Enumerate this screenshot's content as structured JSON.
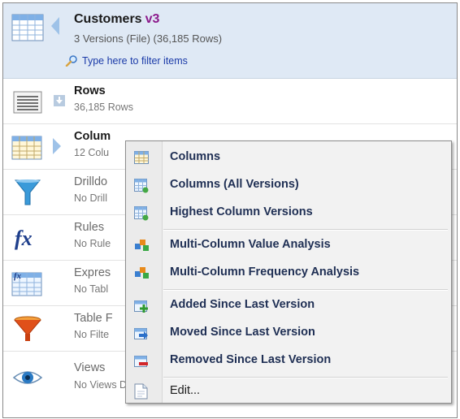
{
  "header": {
    "title": "Customers",
    "version": "v3",
    "subtitle": "3 Versions (File)  (36,185 Rows)",
    "filter_placeholder": "Type here to filter items"
  },
  "rows": [
    {
      "title": "Rows",
      "subtitle": "36,185 Rows"
    },
    {
      "title": "Colum",
      "subtitle": "12 Colu"
    },
    {
      "title": "Drilldo",
      "subtitle": "No Drill"
    },
    {
      "title": "Rules",
      "subtitle": "No Rule"
    },
    {
      "title": "Expres",
      "subtitle": "No Tabl"
    },
    {
      "title": "Table F",
      "subtitle": "No Filte"
    },
    {
      "title": "Views",
      "subtitle": "No Views Defined"
    }
  ],
  "context_menu": {
    "items": [
      {
        "label": "Columns",
        "icon": "columns-table-icon"
      },
      {
        "label": "Columns (All Versions)",
        "icon": "columns-versions-icon"
      },
      {
        "label": "Highest Column Versions",
        "icon": "highest-versions-icon"
      },
      {
        "label": "Multi-Column Value Analysis",
        "icon": "analysis-cubes-icon"
      },
      {
        "label": "Multi-Column Frequency Analysis",
        "icon": "analysis-cubes-icon"
      },
      {
        "label": "Added Since Last Version",
        "icon": "added-column-icon"
      },
      {
        "label": "Moved Since Last Version",
        "icon": "moved-column-icon"
      },
      {
        "label": "Removed Since Last Version",
        "icon": "removed-column-icon"
      },
      {
        "label": "Edit...",
        "icon": "edit-document-icon"
      }
    ]
  },
  "colors": {
    "header_bg": "#dfe9f5",
    "version_color": "#8c1a8c",
    "filter_link": "#1a3aa8",
    "menu_text": "#1f2f54"
  }
}
